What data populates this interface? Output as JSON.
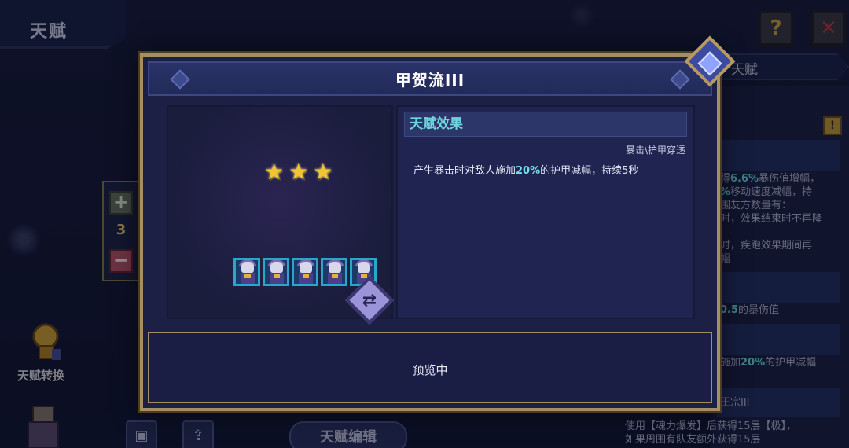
{
  "background": {
    "page_title": "天赋",
    "right_tab_label": "天赋",
    "help_label": "?",
    "close_label": "✕",
    "lock_label": "!",
    "right_panel_lines": [
      {
        "pre": "得",
        "hl": "6.6%",
        "post": "暴伤值增幅，"
      },
      {
        "pre": "",
        "hl": "%",
        "post": "移动速度减幅，持"
      },
      {
        "pre": "",
        "hl": "",
        "post": "围友方数量有："
      },
      {
        "pre": "",
        "hl": "",
        "post": "时，效果结束时不再降"
      },
      {
        "pre": "",
        "hl": "",
        "post": "时，疾跑效果期间再"
      },
      {
        "pre": "",
        "hl": "",
        "post": "幅"
      },
      {
        "pre": "",
        "hl": "0.5",
        "post": "的暴伤值"
      },
      {
        "pre": "施加",
        "hl": "20%",
        "post": "的护甲减幅"
      },
      {
        "pre": "",
        "hl": "",
        "post": "王宗III"
      },
      {
        "pre": "",
        "hl": "",
        "post": "使用【魂力爆发】后获得15层【极】，"
      },
      {
        "pre": "",
        "hl": "",
        "post": "如果周围有队友额外获得15层"
      }
    ],
    "counter_value": "3",
    "plus_label": "+",
    "minus_label": "−",
    "side_char_label": "天赋转换",
    "bottom_edit_label": "天赋编辑",
    "bottom_icon_1": "▣",
    "bottom_icon_2": "⇪"
  },
  "modal": {
    "title": "甲贺流III",
    "stars": [
      "★",
      "★",
      "★"
    ],
    "hero_count": 5,
    "switch_label": "⇄",
    "effect_title": "天赋效果",
    "effect_tags": "暴击\\护甲穿透",
    "effect_desc_pre": "产生暴击时对敌人施加",
    "effect_desc_pct": "20%",
    "effect_desc_post": "的护甲减幅，持续5秒",
    "preview_text": "预览中"
  },
  "colors": {
    "accent": "#6fe0e6",
    "frame": "#a58f62",
    "star": "#f4c430",
    "background": "#131833"
  },
  "icons": [
    "help-icon",
    "close-icon",
    "lock-icon",
    "plus-icon",
    "minus-icon",
    "star-icon",
    "hero-icon",
    "switch-icon",
    "corner-gem-icon"
  ]
}
